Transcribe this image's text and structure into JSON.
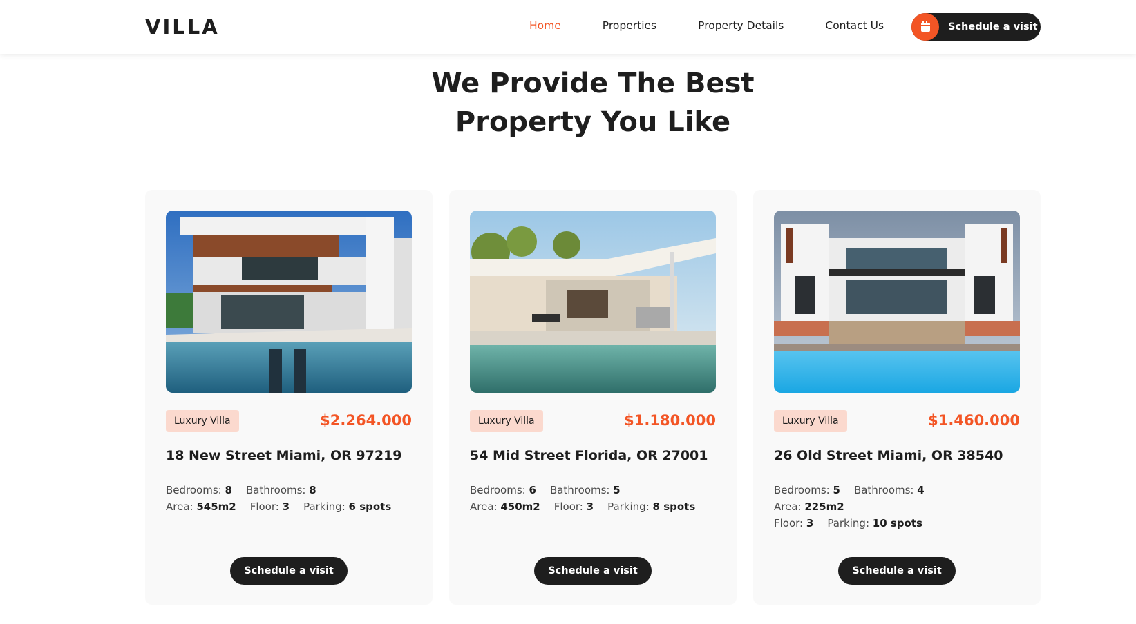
{
  "header": {
    "logo": "VILLA",
    "nav": [
      {
        "label": "Home",
        "active": true
      },
      {
        "label": "Properties",
        "active": false
      },
      {
        "label": "Property Details",
        "active": false
      },
      {
        "label": "Contact Us",
        "active": false
      }
    ],
    "cta_label": "Schedule a visit",
    "cta_icon": "calendar-icon"
  },
  "hero": {
    "line1": "We Provide The Best",
    "line2": "Property You Like"
  },
  "colors": {
    "accent": "#f35525",
    "dark": "#1e1e1e",
    "tag_bg": "#fbd9ce",
    "card_bg": "#f9f9f9"
  },
  "cards": [
    {
      "tag": "Luxury Villa",
      "price": "$2.264.000",
      "address": "18 New Street Miami, OR 97219",
      "features": [
        {
          "label": "Bedrooms:",
          "value": "8"
        },
        {
          "label": "Bathrooms:",
          "value": "8"
        },
        {
          "label": "Area:",
          "value": "545m2"
        },
        {
          "label": "Floor:",
          "value": "3"
        },
        {
          "label": "Parking:",
          "value": "6 spots"
        }
      ],
      "button": "Schedule a visit"
    },
    {
      "tag": "Luxury Villa",
      "price": "$1.180.000",
      "address": "54 Mid Street Florida, OR 27001",
      "features": [
        {
          "label": "Bedrooms:",
          "value": "6"
        },
        {
          "label": "Bathrooms:",
          "value": "5"
        },
        {
          "label": "Area:",
          "value": "450m2"
        },
        {
          "label": "Floor:",
          "value": "3"
        },
        {
          "label": "Parking:",
          "value": "8 spots"
        }
      ],
      "button": "Schedule a visit"
    },
    {
      "tag": "Luxury Villa",
      "price": "$1.460.000",
      "address": "26 Old Street Miami, OR 38540",
      "features": [
        {
          "label": "Bedrooms:",
          "value": "5"
        },
        {
          "label": "Bathrooms:",
          "value": "4"
        },
        {
          "label": "Area:",
          "value": "225m2"
        },
        {
          "label": "Floor:",
          "value": "3"
        },
        {
          "label": "Parking:",
          "value": "10 spots"
        }
      ],
      "button": "Schedule a visit"
    }
  ]
}
